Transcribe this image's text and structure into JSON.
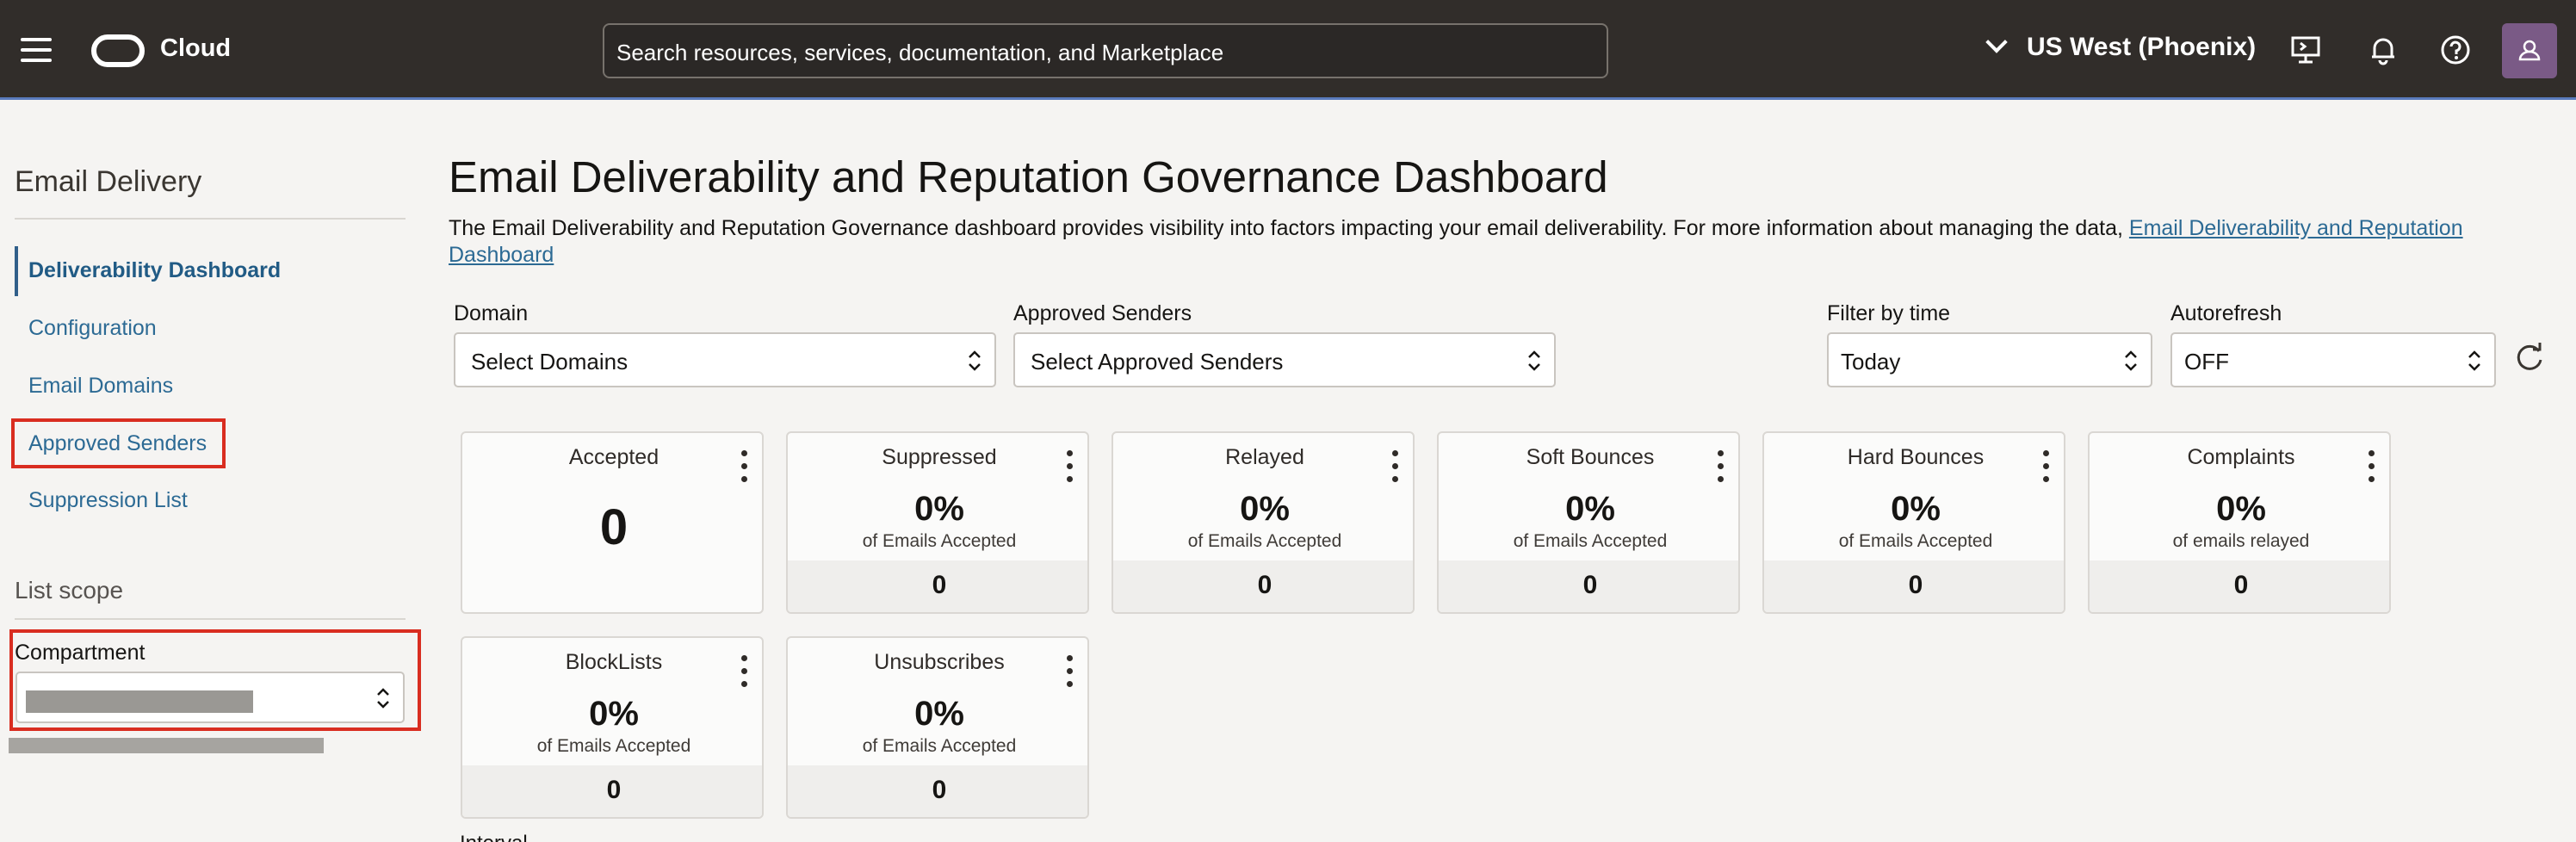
{
  "topbar": {
    "brand": "Cloud",
    "search_placeholder": "Search resources, services, documentation, and Marketplace",
    "region": "US West (Phoenix)"
  },
  "sidebar": {
    "title": "Email Delivery",
    "items": [
      {
        "label": "Deliverability Dashboard",
        "active": true
      },
      {
        "label": "Configuration"
      },
      {
        "label": "Email Domains"
      },
      {
        "label": "Approved Senders"
      },
      {
        "label": "Suppression List"
      }
    ],
    "scope_title": "List scope",
    "compartment_label": "Compartment"
  },
  "main": {
    "title": "Email Deliverability and Reputation Governance Dashboard",
    "description": "The Email Deliverability and Reputation Governance dashboard provides visibility into factors impacting your email deliverability. For more information about managing the data, ",
    "description_link": "Email Deliverability and Reputation Dashboard",
    "filters": {
      "domain_label": "Domain",
      "domain_value": "Select Domains",
      "senders_label": "Approved Senders",
      "senders_value": "Select Approved Senders",
      "time_label": "Filter by time",
      "time_value": "Today",
      "autorefresh_label": "Autorefresh",
      "autorefresh_value": "OFF"
    },
    "cards": [
      {
        "title": "Accepted",
        "value": "0"
      },
      {
        "title": "Suppressed",
        "percent": "0%",
        "subtitle": "of Emails Accepted",
        "count": "0"
      },
      {
        "title": "Relayed",
        "percent": "0%",
        "subtitle": "of Emails Accepted",
        "count": "0"
      },
      {
        "title": "Soft Bounces",
        "percent": "0%",
        "subtitle": "of Emails Accepted",
        "count": "0"
      },
      {
        "title": "Hard Bounces",
        "percent": "0%",
        "subtitle": "of Emails Accepted",
        "count": "0"
      },
      {
        "title": "Complaints",
        "percent": "0%",
        "subtitle": "of emails relayed",
        "count": "0"
      },
      {
        "title": "BlockLists",
        "percent": "0%",
        "subtitle": "of Emails Accepted",
        "count": "0"
      },
      {
        "title": "Unsubscribes",
        "percent": "0%",
        "subtitle": "of Emails Accepted",
        "count": "0"
      }
    ],
    "interval_label": "Interval"
  },
  "colors": {
    "topbar": "#312d2a",
    "link": "#2c6a94",
    "highlight": "#d92d20"
  }
}
